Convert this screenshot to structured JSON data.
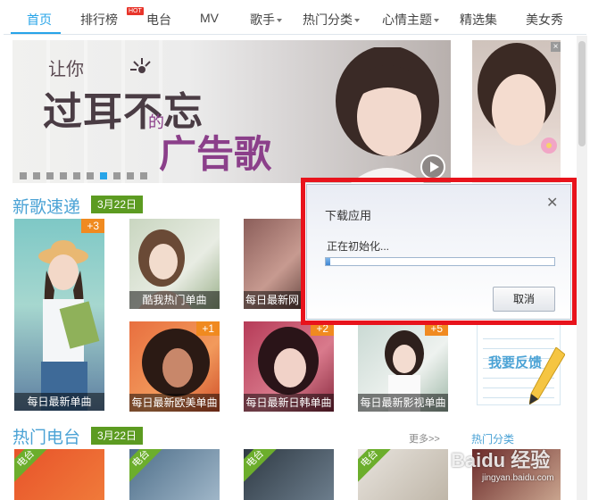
{
  "nav": {
    "items": [
      {
        "label": "首页",
        "active": true
      },
      {
        "label": "排行榜",
        "badge": "HOT"
      },
      {
        "label": "电台"
      },
      {
        "label": "MV"
      },
      {
        "label": "歌手",
        "dropdown": true
      },
      {
        "label": "热门分类",
        "dropdown": true
      },
      {
        "label": "心情主题",
        "dropdown": true
      },
      {
        "label": "精选集"
      },
      {
        "label": "美女秀"
      }
    ]
  },
  "banner": {
    "line1": "让你",
    "line2": "过耳不忘",
    "line3": "的",
    "line4": "广告歌",
    "slide_count": 10,
    "active_slide": 7
  },
  "side_ad": {
    "close_label": "×"
  },
  "new_songs": {
    "title": "新歌速递",
    "date": "3月22日",
    "tiles": [
      {
        "caption": "每日最新单曲",
        "badge": "+3"
      },
      {
        "caption": "酷我热门单曲",
        "badge": ""
      },
      {
        "caption": "每日最新网",
        "badge": ""
      },
      {
        "caption": "每日最新欧美单曲",
        "badge": "+1"
      },
      {
        "caption": "每日最新日韩单曲",
        "badge": "+2"
      },
      {
        "caption": "每日最新影视单曲",
        "badge": "+5"
      }
    ],
    "feedback": "我要反馈"
  },
  "hot_radio": {
    "title": "热门电台",
    "date": "3月22日",
    "more": "更多>>",
    "category_link": "热门分类",
    "radio_badge": "电台"
  },
  "dialog": {
    "title": "下载应用",
    "status": "正在初始化...",
    "close": "✕",
    "cancel": "取消",
    "progress": 0.02
  },
  "watermark": {
    "main": "Baidu 经验",
    "sub": "jingyan.baidu.com"
  },
  "colors": {
    "accent": "#27a4e8",
    "section_title": "#4aa2d5",
    "date_badge": "#5c9b21",
    "highlight": "#e8131c",
    "plus_badge": "#f08a20"
  }
}
